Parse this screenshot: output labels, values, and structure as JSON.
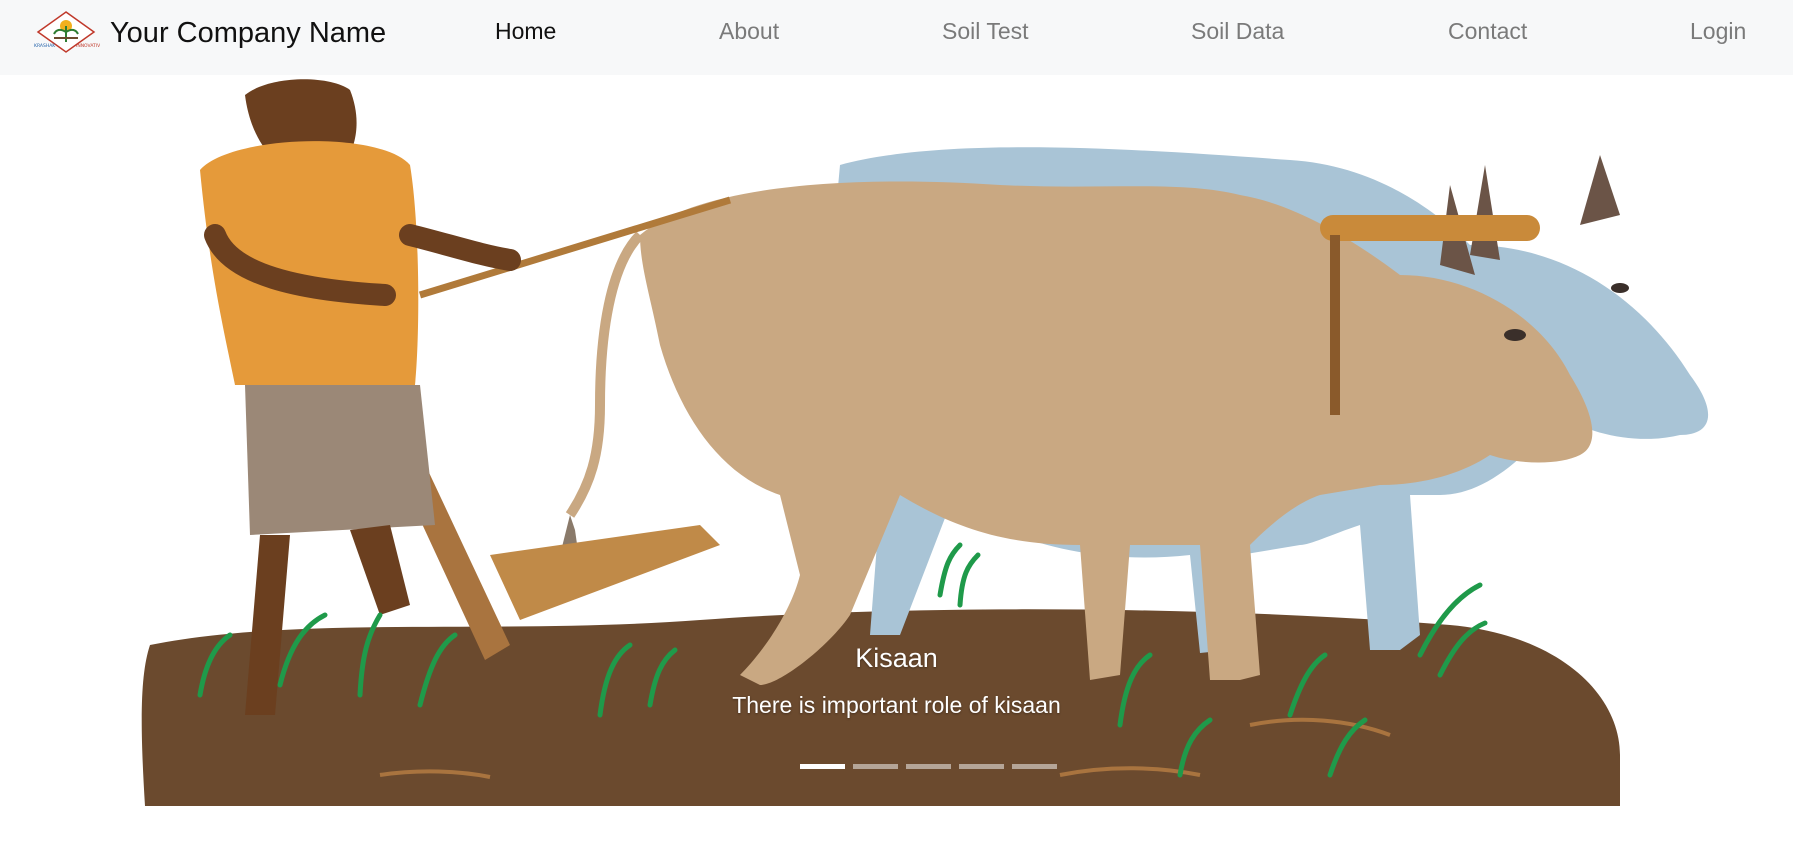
{
  "brand": {
    "name": "Your Company Name",
    "logo_text_left": "KRASHAK",
    "logo_text_right": "INNOVATIVE"
  },
  "nav": {
    "items": [
      {
        "label": "Home",
        "active": true
      },
      {
        "label": "About",
        "active": false
      },
      {
        "label": "Soil Test",
        "active": false
      },
      {
        "label": "Soil Data",
        "active": false
      },
      {
        "label": "Contact",
        "active": false
      },
      {
        "label": "Login",
        "active": false
      }
    ]
  },
  "carousel": {
    "caption_title": "Kisaan",
    "caption_text": "There is important role of kisaan",
    "slide_count": 5,
    "active_slide": 1
  },
  "colors": {
    "navbar_bg": "#f7f8f9",
    "nav_active": "#111111",
    "nav_inactive": "#7a7a7a",
    "soil": "#6b4a2e",
    "grass": "#1f9a4a",
    "farmer_shirt": "#e59a3a",
    "ox_tan": "#c9a882",
    "ox_blue": "#a9c4d6"
  }
}
